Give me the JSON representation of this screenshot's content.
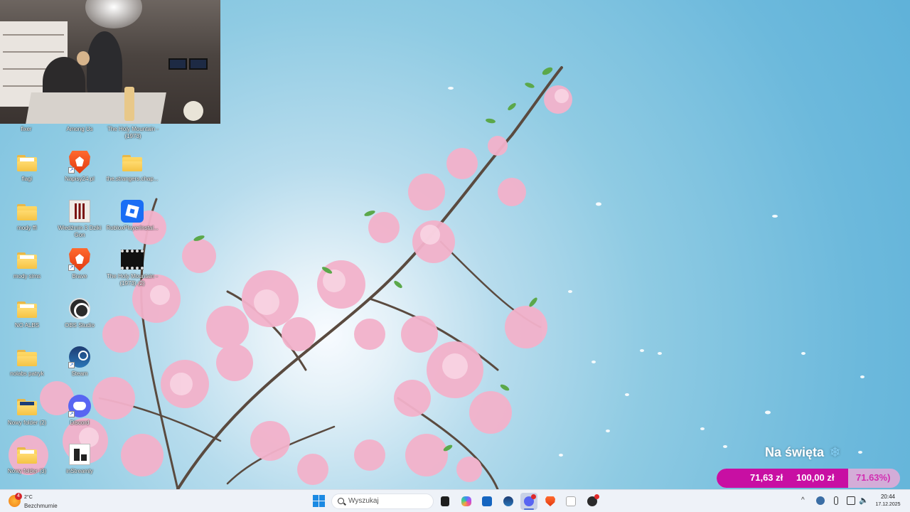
{
  "desktop": {
    "top_labels": [
      "fixer",
      "Among Us",
      "The Holy Mountain - (1973)"
    ],
    "icons": [
      {
        "label": "flagi",
        "type": "folder"
      },
      {
        "label": "mody ffl",
        "type": "folder"
      },
      {
        "label": "mody sims",
        "type": "folder"
      },
      {
        "label": "NO ALBS",
        "type": "folder"
      },
      {
        "label": "nolabs patryk",
        "type": "folder"
      },
      {
        "label": "Nowy folder (2)",
        "type": "folder"
      },
      {
        "label": "Nowy folder (3)",
        "type": "folder"
      },
      {
        "label": "Napisy24.pl",
        "type": "brave-icon"
      },
      {
        "label": "Wiedźmin 3 Dziki Gon",
        "type": "witcher-icon"
      },
      {
        "label": "Brave",
        "type": "brave-icon"
      },
      {
        "label": "OBS Studio",
        "type": "obs-icon"
      },
      {
        "label": "Steam",
        "type": "steam-icon"
      },
      {
        "label": "Discord",
        "type": "discord-icon"
      },
      {
        "label": "inStreamly",
        "type": "instreamly-icon"
      },
      {
        "label": "the.strangers.chap...",
        "type": "folder"
      },
      {
        "label": "RobloxPlayerInstal...",
        "type": "roblox-icon"
      },
      {
        "label": "The Holy Mountain - (1973) (2)",
        "type": "film-icon"
      }
    ]
  },
  "donation_goal": {
    "title": "Na święta",
    "current": "71,63 zł",
    "target": "100,00 zł",
    "percent_text": "71.63%)",
    "progress": 0.7163,
    "accent": "#c80fa3"
  },
  "taskbar": {
    "weather": {
      "temperature": "2°C",
      "condition": "Bezchmurnie",
      "badge": "4"
    },
    "search_placeholder": "Wyszukaj",
    "clock": {
      "time": "20:44",
      "date": "17.12.2025"
    },
    "apps": [
      "file-explorer-icon",
      "copilot-icon",
      "microsoft-store-icon",
      "steam-icon",
      "discord-icon",
      "brave-icon",
      "notepad-icon",
      "obs-icon"
    ]
  }
}
